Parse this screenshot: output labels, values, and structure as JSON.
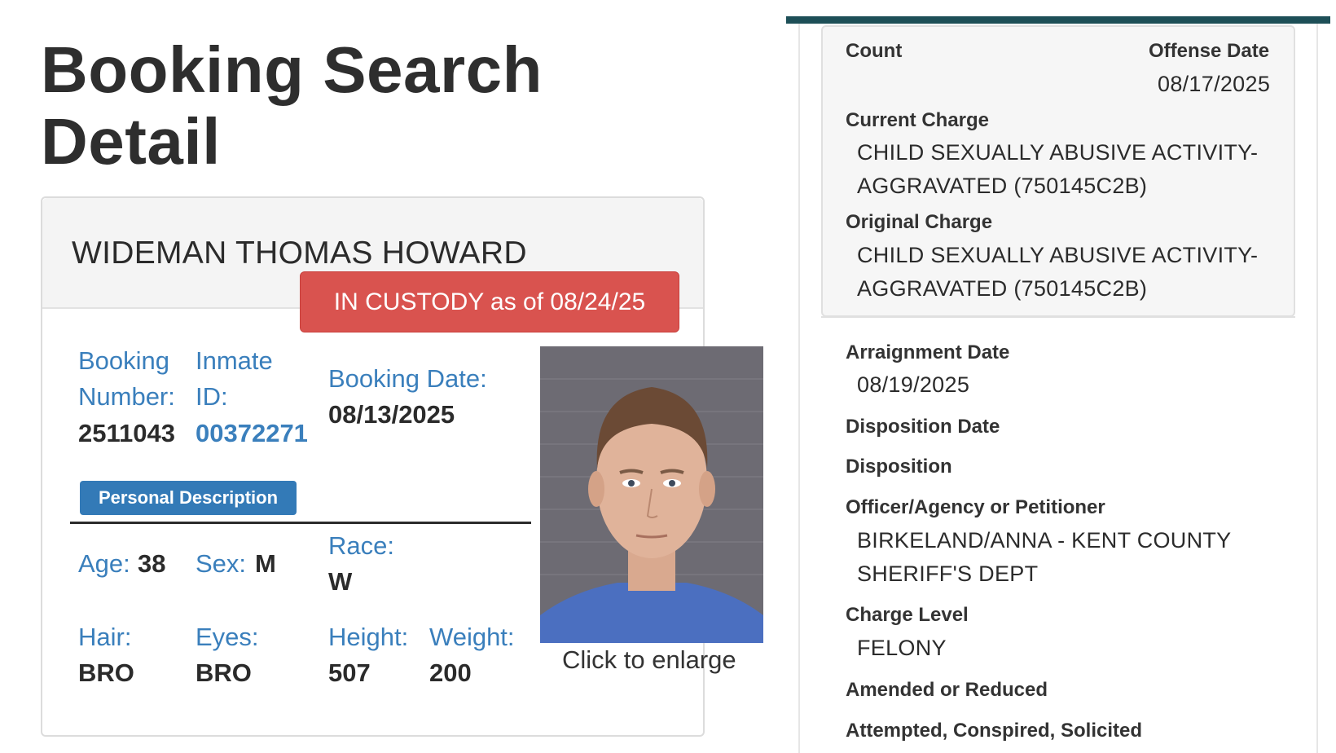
{
  "page": {
    "title_line1": "Booking Search",
    "title_line2": "Detail"
  },
  "inmate": {
    "name": "WIDEMAN THOMAS HOWARD",
    "status_badge": "IN CUSTODY as of 08/24/25",
    "booking_number_label_1": "Booking",
    "booking_number_label_2": "Number:",
    "booking_number": "2511043",
    "inmate_id_label_1": "Inmate",
    "inmate_id_label_2": "ID:",
    "inmate_id": "00372271",
    "booking_date_label": "Booking Date:",
    "booking_date": "08/13/2025",
    "photo_caption": "Click to enlarge"
  },
  "personal_description": {
    "tab_label": "Personal Description",
    "age_label": "Age:",
    "age": "38",
    "sex_label": "Sex:",
    "sex": "M",
    "race_label": "Race:",
    "race": "W",
    "hair_label": "Hair:",
    "hair": "BRO",
    "eyes_label": "Eyes:",
    "eyes": "BRO",
    "height_label": "Height:",
    "height": "507",
    "weight_label": "Weight:",
    "weight": "200"
  },
  "charge": {
    "count_label": "Count",
    "offense_date_label": "Offense Date",
    "offense_date": "08/17/2025",
    "current_charge_label": "Current Charge",
    "current_charge_line1": "CHILD SEXUALLY ABUSIVE ACTIVITY-",
    "current_charge_line2": "AGGRAVATED (750145C2B)",
    "original_charge_label": "Original Charge",
    "original_charge_line1": "CHILD SEXUALLY ABUSIVE ACTIVITY-",
    "original_charge_line2": "AGGRAVATED (750145C2B)",
    "arraignment_date_label": "Arraignment Date",
    "arraignment_date": "08/19/2025",
    "disposition_date_label": "Disposition Date",
    "disposition_label": "Disposition",
    "officer_label": "Officer/Agency or Petitioner",
    "officer_line1": "BIRKELAND/ANNA - KENT COUNTY",
    "officer_line2": "SHERIFF'S DEPT",
    "charge_level_label": "Charge Level",
    "charge_level": "FELONY",
    "amended_label": "Amended or Reduced",
    "attempted_label": "Attempted, Conspired, Solicited"
  },
  "colors": {
    "accent_blue": "#3a7fbc",
    "custody_red": "#d9534f",
    "top_bar": "#1d4f57"
  }
}
